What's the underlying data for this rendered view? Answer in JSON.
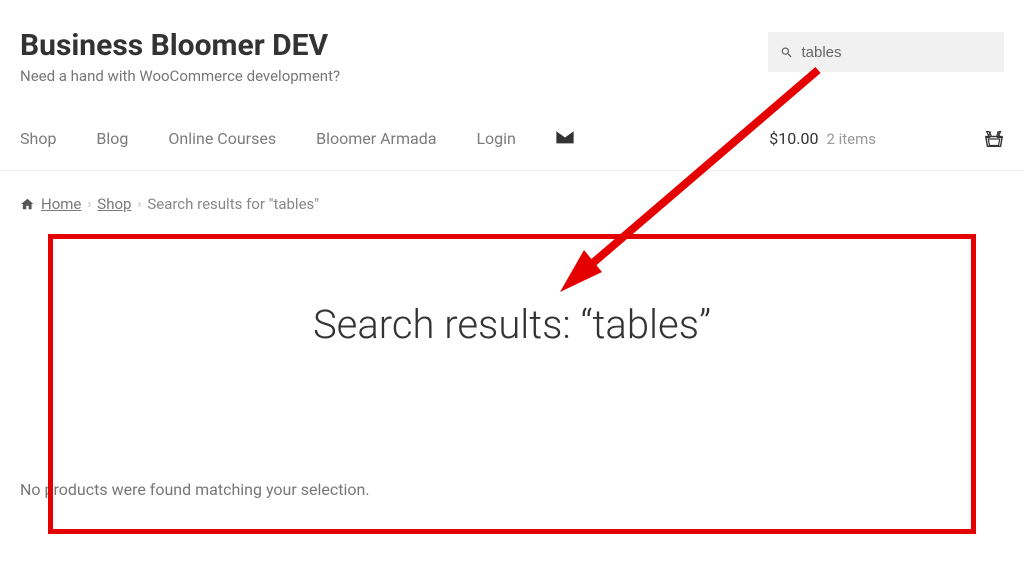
{
  "site": {
    "title": "Business Bloomer DEV",
    "tagline": "Need a hand with WooCommerce development?"
  },
  "search": {
    "value": "tables"
  },
  "nav": {
    "items": [
      "Shop",
      "Blog",
      "Online Courses",
      "Bloomer Armada",
      "Login"
    ]
  },
  "cart": {
    "price": "$10.00",
    "items_label": "2 items"
  },
  "breadcrumb": {
    "home": "Home",
    "shop": "Shop",
    "current": "Search results for \"tables\""
  },
  "main": {
    "title": "Search results: “tables”",
    "no_results": "No products were found matching your selection."
  }
}
